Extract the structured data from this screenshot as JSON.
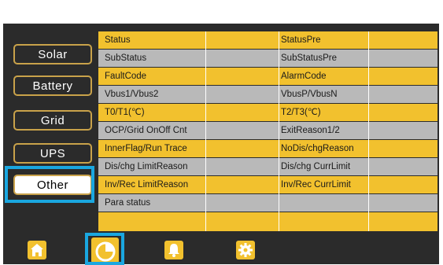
{
  "sidebar": {
    "items": [
      {
        "label": "Solar"
      },
      {
        "label": "Battery"
      },
      {
        "label": "Grid"
      },
      {
        "label": "UPS"
      },
      {
        "label": "Other"
      }
    ],
    "selected": "Other"
  },
  "table": {
    "rows": [
      {
        "c1": "Status",
        "c3": "StatusPre"
      },
      {
        "c1": "SubStatus",
        "c3": "SubStatusPre"
      },
      {
        "c1": "FaultCode",
        "c3": "AlarmCode"
      },
      {
        "c1": "Vbus1/Vbus2",
        "c3": "VbusP/VbusN"
      },
      {
        "c1": "T0/T1(℃)",
        "c3": "T2/T3(℃)"
      },
      {
        "c1": "OCP/Grid OnOff Cnt",
        "c3": "ExitReason1/2"
      },
      {
        "c1": "InnerFlag/Run Trace",
        "c3": "NoDis/chgReason"
      },
      {
        "c1": "Dis/chg LimitReason",
        "c3": "Dis/chg CurrLimit"
      },
      {
        "c1": "Inv/Rec LimitReason",
        "c3": "Inv/Rec CurrLimit"
      },
      {
        "c1": "Para status",
        "c3": ""
      },
      {
        "c1": "",
        "c3": ""
      }
    ]
  },
  "bottom_nav": {
    "items": [
      {
        "icon": "home-icon"
      },
      {
        "icon": "pie-chart-icon"
      },
      {
        "icon": "bell-icon"
      },
      {
        "icon": "gear-icon"
      }
    ],
    "selected": "pie-chart-icon"
  },
  "colors": {
    "accent": "#f2c12e",
    "selection": "#1aa7e0",
    "panel": "#2b2b2b",
    "row_alt": "#b9b9b9"
  }
}
